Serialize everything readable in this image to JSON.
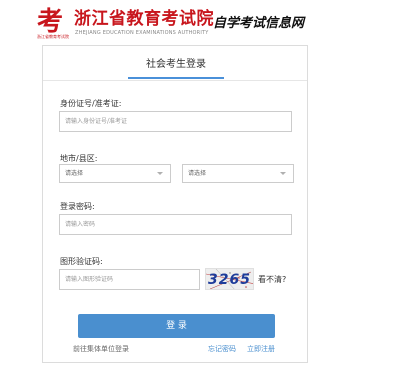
{
  "header": {
    "logo_char": "考",
    "logo_subtext": "浙江省教育考试院",
    "title": "浙江省教育考试院",
    "subtitle_en": "ZHEJIANG EDUCATION EXAMINATIONS AUTHORITY",
    "slogan": "自学考试信息网"
  },
  "tab": {
    "label": "社会考生登录"
  },
  "form": {
    "id_label": "身份证号/准考证:",
    "id_placeholder": "请输入身份证号/准考证",
    "region_label": "地市/县区:",
    "city_select": "请选择",
    "district_select": "请选择",
    "password_label": "登录密码:",
    "password_placeholder": "请输入密码",
    "captcha_label": "图形验证码:",
    "captcha_placeholder": "请输入图形验证码",
    "captcha_text": "3265",
    "refresh_label": "看不清?",
    "login_button": "登 录"
  },
  "links": {
    "unit_login": "前往集体单位登录",
    "forgot_password": "忘记密码",
    "register": "立即注册"
  },
  "colors": {
    "brand_red": "#c8161d",
    "accent_blue": "#4a8fcf"
  },
  "icons": {
    "select_chevron": "chevron-down-icon",
    "logo": "exam-authority-logo-icon"
  }
}
